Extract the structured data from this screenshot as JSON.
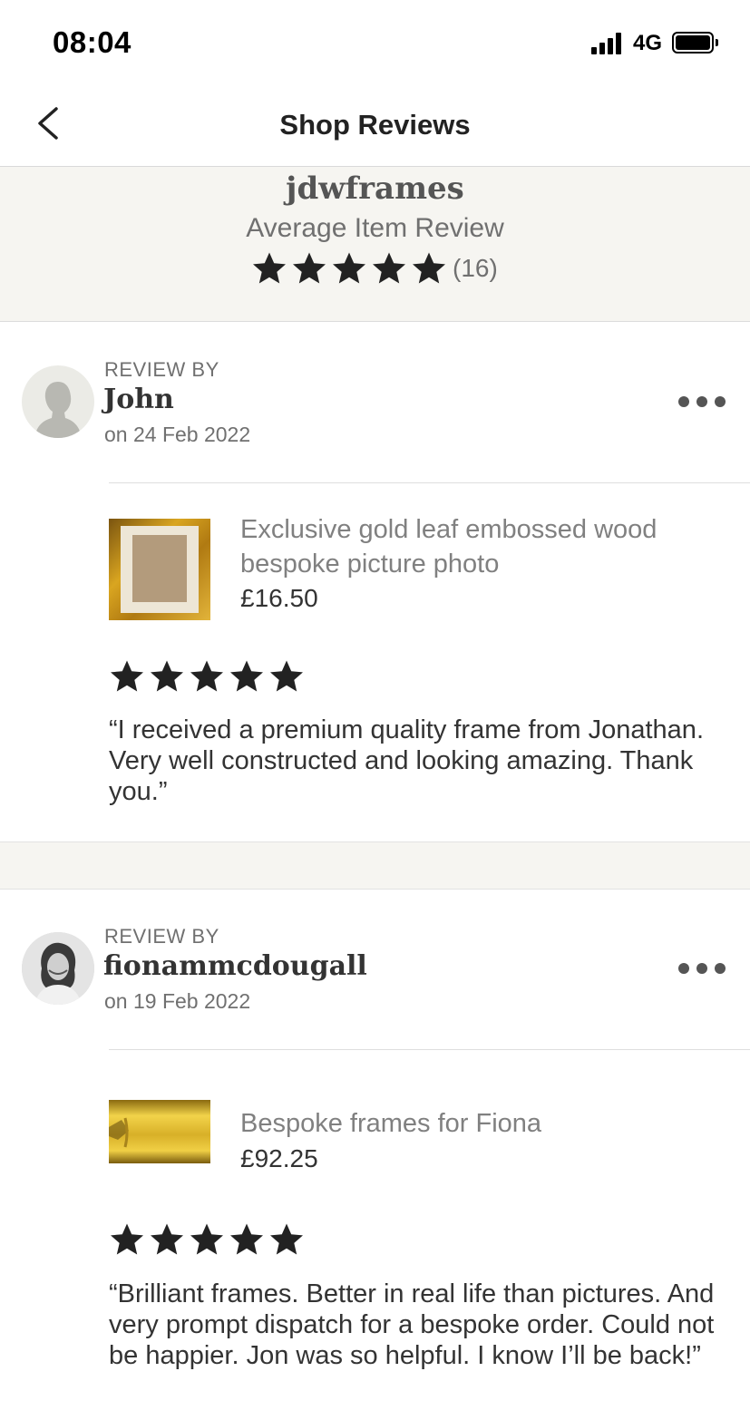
{
  "status_bar": {
    "time": "08:04",
    "network": "4G"
  },
  "nav": {
    "title": "Shop Reviews",
    "back_icon": "chevron-left-icon"
  },
  "shop": {
    "name": "jdwframes",
    "average_label": "Average Item Review",
    "rating": 5,
    "review_count": "(16)"
  },
  "reviews": [
    {
      "review_by_label": "REVIEW BY",
      "reviewer": "John",
      "date": "on 24 Feb 2022",
      "item_title": "Exclusive gold leaf embossed wood bespoke picture photo",
      "item_price": "£16.50",
      "rating": 5,
      "text": "“I received a premium quality frame from Jonathan. Very well constructed and looking amazing. Thank you.”"
    },
    {
      "review_by_label": "REVIEW BY",
      "reviewer": "fionammcdougall",
      "date": "on 19 Feb 2022",
      "item_title": "Bespoke frames for Fiona",
      "item_price": "£92.25",
      "rating": 5,
      "text": "“Brilliant frames. Better in real life than pictures. And very prompt dispatch for a bespoke order. Could not be happier. Jon was so helpful. I know I’ll be back!”"
    }
  ],
  "colors": {
    "star": "#222222",
    "band": "#f6f5f1",
    "gold": "#c9a227"
  }
}
